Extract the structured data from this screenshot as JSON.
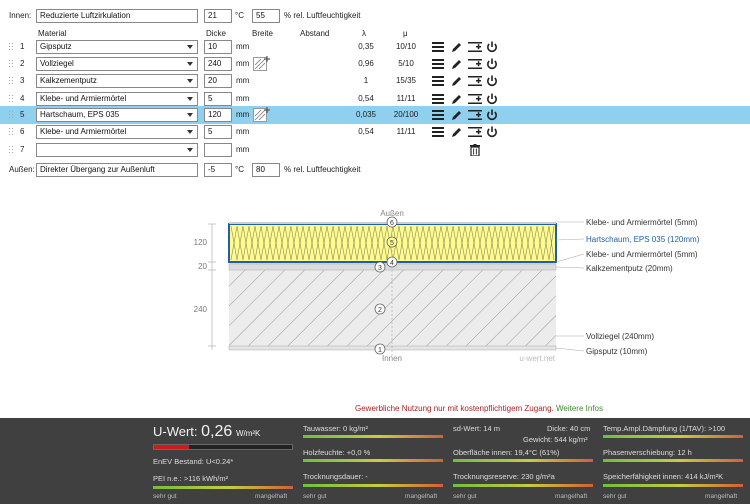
{
  "inside": {
    "label": "Innen:",
    "name": "Reduzierte Luftzirkulation",
    "temp": "21",
    "temp_unit": "°C",
    "humidity": "55",
    "humidity_unit": "% rel. Luftfeuchtigkeit"
  },
  "outside": {
    "label": "Außen:",
    "name": "Direkter Übergang zur Außenluft",
    "temp": "-5",
    "temp_unit": "°C",
    "humidity": "80",
    "humidity_unit": "% rel. Luftfeuchtigkeit"
  },
  "headers": {
    "material": "Material",
    "thickness": "Dicke",
    "width": "Breite",
    "spacing": "Abstand",
    "lambda": "λ",
    "mu": "μ"
  },
  "unit_mm": "mm",
  "layers": [
    {
      "n": "1",
      "material": "Gipsputz",
      "thickness": "10",
      "lambda": "0,35",
      "mu": "10/10"
    },
    {
      "n": "2",
      "material": "Vollziegel",
      "thickness": "240",
      "lambda": "0,96",
      "mu": "5/10"
    },
    {
      "n": "3",
      "material": "Kalkzementputz",
      "thickness": "20",
      "lambda": "1",
      "mu": "15/35"
    },
    {
      "n": "4",
      "material": "Klebe- und Armiermörtel",
      "thickness": "5",
      "lambda": "0,54",
      "mu": "11/11"
    },
    {
      "n": "5",
      "material": "Hartschaum, EPS 035",
      "thickness": "120",
      "lambda": "0,035",
      "mu": "20/100"
    },
    {
      "n": "6",
      "material": "Klebe- und Armiermörtel",
      "thickness": "5",
      "lambda": "0,54",
      "mu": "11/11"
    },
    {
      "n": "7",
      "material": "",
      "thickness": "",
      "lambda": "",
      "mu": ""
    }
  ],
  "diagram": {
    "top_label": "Außen",
    "bottom_label": "Innen",
    "watermark": "u-wert.net",
    "dim_120": "120",
    "dim_20": "20",
    "dim_240": "240",
    "right_labels": [
      "Klebe- und Armiermörtel (5mm)",
      "Hartschaum, EPS 035 (120mm)",
      "Klebe- und Armiermörtel (5mm)",
      "Kalkzementputz (20mm)",
      "Vollziegel (240mm)",
      "Gipsputz (10mm)"
    ],
    "markers": [
      "6",
      "5",
      "4",
      "3",
      "2",
      "1"
    ]
  },
  "notice": {
    "text": "Gewerbliche Nutzung nur mit kostenpflichtigem Zugang.",
    "link": "Weitere Infos"
  },
  "results": {
    "uwert_label": "U-Wert:",
    "uwert_value": "0,26",
    "uwert_unit": "W/m²K",
    "enev": "EnEV Bestand: U<0.24*",
    "pei": "PEI n.e.: >116 kWh/m²",
    "good": "sehr gut",
    "bad": "mangelhaft",
    "tauwasser": "Tauwasser: 0 kg/m²",
    "holzfeuchte": "Holzfeuchte: +0,0 %",
    "trocknungsdauer": "Trocknungsdauer: -",
    "sdwert": "sd-Wert: 14 m",
    "dicke": "Dicke: 40 cm",
    "gewicht": "Gewicht: 544 kg/m²",
    "oberflaeche": "Oberfläche innen: 19,4°C (61%)",
    "trocknungsreserve": "Trocknungsreserve: 230 g/m²a",
    "temp_ampl": "Temp.Ampl.Dämpfung (1/TAV): >100",
    "phasen": "Phasenverschiebung: 12 h",
    "speicher": "Speicherfähigkeit innen: 414 kJ/m²K"
  },
  "colors": {
    "highlight": "#8fd0ee",
    "insulation": "#fffb8c",
    "selected_border": "#1f5fa8",
    "notice": "#aa2222",
    "link": "#3a8a2a",
    "dark_panel": "#404040"
  }
}
